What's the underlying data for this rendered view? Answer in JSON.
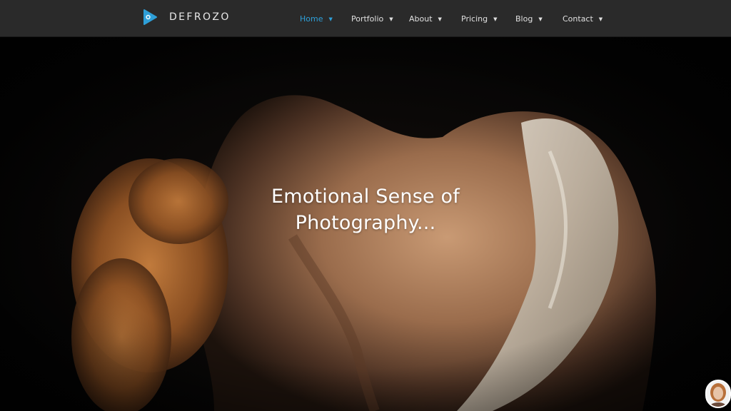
{
  "brand": {
    "name": "DEFROZO",
    "logo_icon": "play-triangle-icon",
    "logo_color": "#2e9fd8"
  },
  "nav": {
    "items": [
      {
        "label": "Home",
        "active": true
      },
      {
        "label": "Portfolio",
        "active": false
      },
      {
        "label": "About",
        "active": false
      },
      {
        "label": "Pricing",
        "active": false
      },
      {
        "label": "Blog",
        "active": false
      },
      {
        "label": "Contact",
        "active": false
      }
    ],
    "caret_icon": "chevron-down-icon",
    "active_color": "#2e9fd8",
    "bar_color": "#2a2a2a"
  },
  "hero": {
    "headline_line1": "Emotional Sense of",
    "headline_line2": "Photography...",
    "image": "hero-photograph"
  },
  "chat": {
    "avatar_icon": "chat-avatar-icon"
  }
}
